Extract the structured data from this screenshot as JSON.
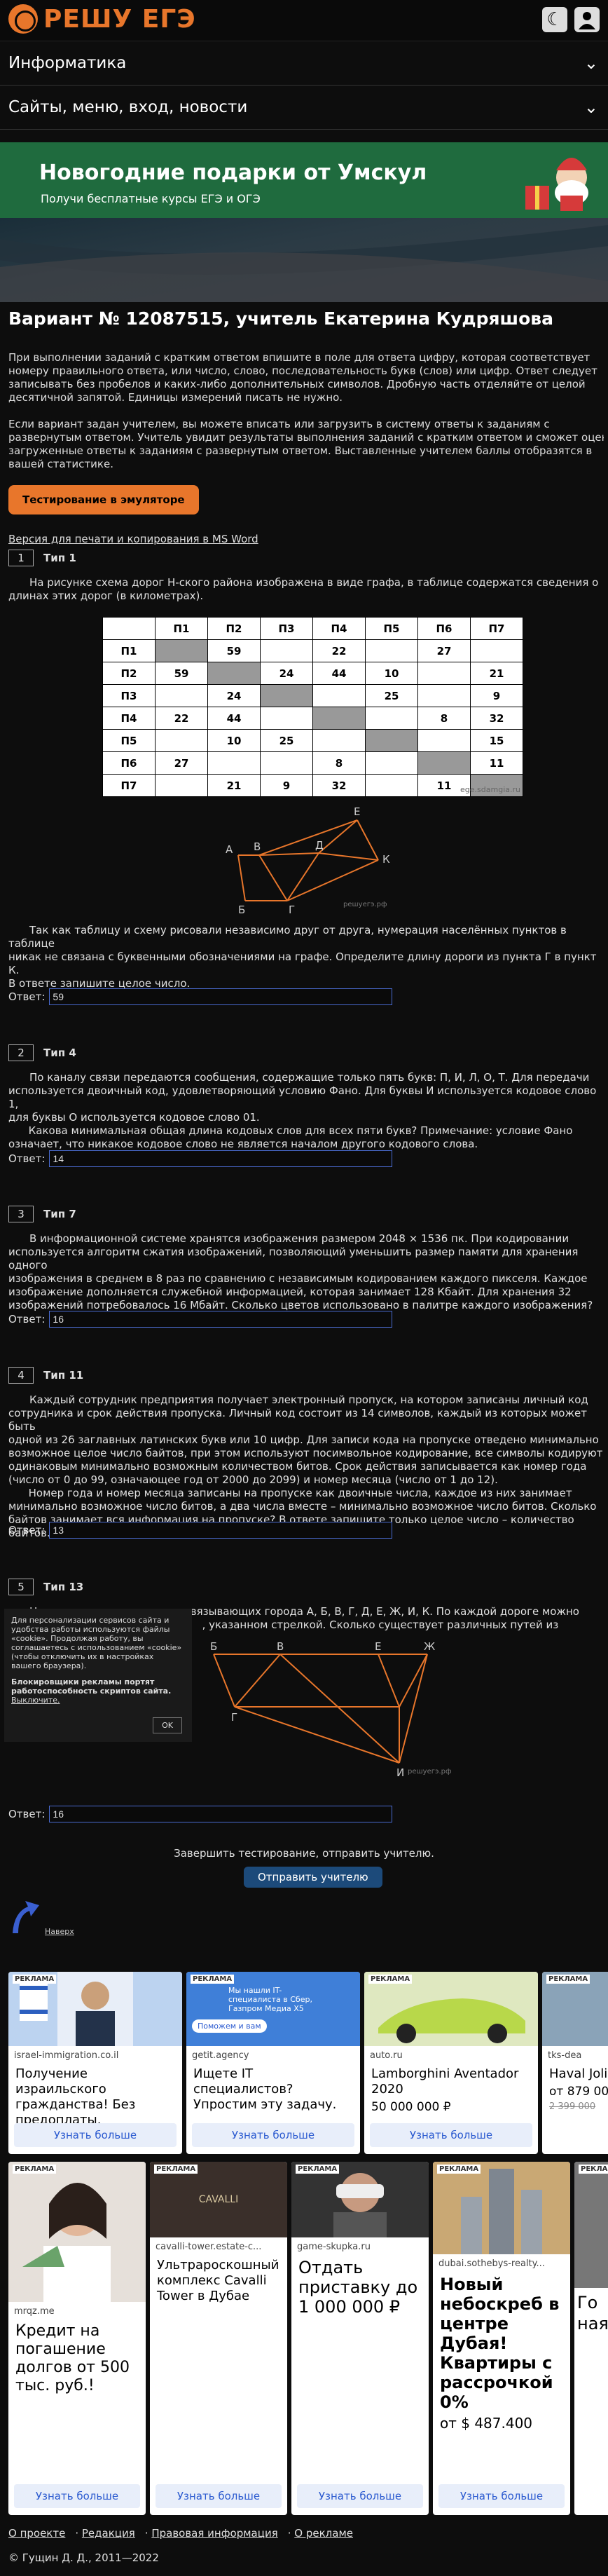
{
  "header": {
    "logo_text": "РЕШУ ЕГЭ"
  },
  "menu": [
    "Информатика",
    "Сайты, меню, вход, новости"
  ],
  "banner": {
    "title": "Новогодние подарки от Умскул",
    "subtitle": "Получи бесплатные курсы ЕГЭ и ОГЭ"
  },
  "variant": {
    "title": "Вариант № 12087515, учитель Екатерина Кудряшова",
    "intro1": "При выполнении заданий с кратким ответом впишите в поле для ответа цифру, которая соответствует\nномеру правильного ответа, или число, слово, последовательность букв (слов) или цифр. Ответ следует\nзаписывать без пробелов и каких-либо дополнительных символов. Дробную часть отделяйте от целой\nдесятичной запятой. Единицы измерений писать не нужно.",
    "intro2": "Если вариант задан учителем, вы можете вписать или загрузить в систему ответы к заданиям с\nразвернутым ответом. Учитель увидит результаты выполнения заданий с кратким ответом и сможет оценить\nзагруженные ответы к заданиям с развернутым ответом. Выставленные учителем баллы отобразятся в\nвашей статистике.",
    "emulator_btn": "Тестирование в эмуляторе",
    "print_link": "Версия для печати и копирования в MS Word"
  },
  "answer_label": "Ответ:",
  "tasks": [
    {
      "num": "1",
      "type": "Тип 1",
      "text": "На рисунке схема дорог Н-ского района изображена в виде графа, в таблице содержатся сведения о\nдлинах этих дорог (в километрах).",
      "text2": "Так как таблицу и схему рисовали независимо друг от друга, нумерация населённых пунктов в таблице\nникак не связана с буквенными обозначениями на графе. Определите длину дороги из пункта Г в пункт К.\nВ ответе запишите целое число.",
      "answer": "59"
    },
    {
      "num": "2",
      "type": "Тип 4",
      "text": "По каналу связи передаются сообщения, содержащие только пять букв: П, И, Л, О, Т. Для передачи\nиспользуется двоичный код, удовлетворяющий условию Фано. Для буквы И используется кодовое слово 1,\nдля буквы О используется кодовое слово 01.\n      Какова минимальная общая длина кодовых слов для всех пяти букв? Примечание: условие Фано\nозначает, что никакое кодовое слово не является началом другого кодового слова.",
      "answer": "14"
    },
    {
      "num": "3",
      "type": "Тип 7",
      "text": "В информационной системе хранятся изображения размером 2048 × 1536 пк. При кодировании\nиспользуется алгоритм сжатия изображений, позволяющий уменьшить размер памяти для хранения одного\nизображения в среднем в 8 раз по сравнению с независимым кодированием каждого пикселя. Каждое\nизображение дополняется служебной информацией, которая занимает 128 Кбайт. Для хранения 32\nизображений потребовалось 16 Мбайт. Сколько цветов использовано в палитре каждого изображения?",
      "answer": "16"
    },
    {
      "num": "4",
      "type": "Тип 11",
      "text": "Каждый сотрудник предприятия получает электронный пропуск, на котором записаны личный код\nсотрудника и срок действия пропуска. Личный код состоит из 14 символов, каждый из которых может быть\nодной из 26 заглавных латинских букв или 10 цифр. Для записи кода на пропуске отведено минимально\nвозможное целое число байтов, при этом используют посимвольное кодирование, все символы кодируют\nодинаковым минимально возможным количеством битов. Срок действия записывается как номер года\n(число от 0 до 99, означающее год от 2000 до 2099) и номер месяца (число от 1 до 12).\n      Номер года и номер месяца записаны на пропуске как двоичные числа, каждое из них занимает\nминимально возможное число битов, а два числа вместе – минимально возможное число битов. Сколько\nбайтов занимает вся информация на пропуске? В ответе запишите только целое число – количество байтов.",
      "answer": "13"
    },
    {
      "num": "5",
      "type": "Тип 13",
      "text": "На рисунке — схема дорог, связывающих города А, Б, В, Г, Д, Е, Ж, И, К. По каждой дороге можно\n                                                          , указанном стрелкой. Сколько существует различных путей из",
      "answer": "16"
    }
  ],
  "table": {
    "headers": [
      "",
      "П1",
      "П2",
      "П3",
      "П4",
      "П5",
      "П6",
      "П7"
    ],
    "rows": [
      [
        "П1",
        "",
        "59",
        "",
        "22",
        "",
        "27",
        ""
      ],
      [
        "П2",
        "59",
        "",
        "24",
        "44",
        "10",
        "",
        "21"
      ],
      [
        "П3",
        "",
        "24",
        "",
        "",
        "25",
        "",
        "9"
      ],
      [
        "П4",
        "22",
        "44",
        "",
        "",
        "",
        "8",
        "32"
      ],
      [
        "П5",
        "",
        "10",
        "25",
        "",
        "",
        "",
        "15"
      ],
      [
        "П6",
        "27",
        "",
        "",
        "8",
        "",
        "",
        "11"
      ],
      [
        "П7",
        "",
        "21",
        "9",
        "32",
        "",
        "11",
        ""
      ]
    ],
    "watermark": "ege.sdamgia.ru"
  },
  "graph1": {
    "nodes": [
      "А",
      "В",
      "Д",
      "Е",
      "К",
      "Б",
      "Г"
    ],
    "watermark": "решуегэ.рф"
  },
  "graph5": {
    "nodes": [
      "Б",
      "В",
      "Е",
      "Ж",
      "Г",
      "И"
    ],
    "watermark": "решуегэ.рф"
  },
  "cookie": {
    "text": "Для персонализации сервисов сайта и удобства работы используются файлы «cookie». Продолжая работу, вы соглашаетесь с использованием «cookie» (чтобы отключить их в настройках вашего браузера).",
    "block": "Блокировщики рекламы портят работоспособность скриптов сайта.",
    "disable": "Выключите.",
    "ok": "OK"
  },
  "finish": {
    "text": "Завершить тестирование, отправить учителю.",
    "button": "Отправить учителю"
  },
  "nav_up": "Наверх",
  "ads_row1": [
    {
      "label": "РЕКЛАМА",
      "domain": "israel-immigration.co.il",
      "title": "Получение израильского гражданства! Без предоплаты.",
      "price": "",
      "button": "Узнать больше",
      "color": "#bcd3f0"
    },
    {
      "label": "РЕКЛАМА",
      "domain": "getit.agency",
      "title": "Ищете IT специалистов? Упростим эту задачу.",
      "price": "",
      "button": "Узнать больше",
      "color": "#3f7fd8",
      "img_text": "Мы нашли IT-специалиста в Сбер, Газпром Медиа Х5",
      "img_btn": "Поможем и вам"
    },
    {
      "label": "РЕКЛАМА",
      "domain": "auto.ru",
      "title": "Lamborghini Aventador 2020",
      "price": "50 000 000 ₽",
      "button": "Узнать больше",
      "color": "#b8d84a"
    },
    {
      "label": "РЕКЛАМА",
      "domain": "tks-dea",
      "title": "Haval Jolio",
      "price": "от 879 000",
      "old_price": "2 399 000",
      "button": "",
      "color": "#8aa3b8"
    }
  ],
  "ads_row2": [
    {
      "label": "РЕКЛАМА",
      "domain": "mrqz.me",
      "title": "Кредит на погашение долгов от 500 тыс. руб.!",
      "button": "Узнать больше",
      "color": "#e6e0da"
    },
    {
      "label": "РЕКЛАМА",
      "domain": "cavalli-tower.estate-c...",
      "title": "Ультрароскошный комплекс Cavalli Tower в Дубае",
      "button": "Узнать больше",
      "color": "#3a2f2a",
      "img_text": "CAVALLI"
    },
    {
      "label": "РЕКЛАМА",
      "domain": "game-skupka.ru",
      "title": "Отдать приставку до 1 000 000 ₽",
      "button": "Узнать больше",
      "color": "#333"
    },
    {
      "label": "РЕКЛАМА",
      "domain": "dubai.sothebys-realty...",
      "title": "Новый небоскреб в центре Дубая! Квартиры с рассрочкой 0%",
      "price": "от $ 487.400",
      "button": "Узнать больше",
      "color": "#c9a874"
    },
    {
      "label": "РЕКЛАМА",
      "domain": "",
      "title": "Го ная",
      "button": "",
      "color": "#777"
    }
  ],
  "footer": {
    "links": [
      "О проекте",
      "Редакция",
      "Правовая информация",
      "О рекламе"
    ],
    "copy": "© Гущин Д. Д., 2011—2022"
  }
}
